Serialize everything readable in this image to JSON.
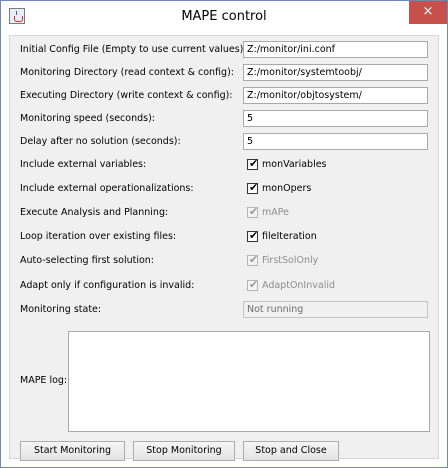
{
  "window": {
    "title": "MAPE control",
    "close_label": "×"
  },
  "fields": {
    "initial_config": {
      "label": "Initial Config File (Empty to use current values):",
      "value": "Z:/monitor/ini.conf"
    },
    "monitoring_dir": {
      "label": "Monitoring Directory (read context & config):",
      "value": "Z:/monitor/systemtoobj/"
    },
    "executing_dir": {
      "label": "Executing Directory (write context & config):",
      "value": "Z:/monitor/objtosystem/"
    },
    "monitoring_speed": {
      "label": "Monitoring speed (seconds):",
      "value": "5"
    },
    "delay": {
      "label": "Delay after no solution (seconds):",
      "value": "5"
    }
  },
  "options": {
    "ext_vars": {
      "label": "Include external variables:",
      "check_label": "monVariables",
      "checked": true,
      "enabled": true
    },
    "ext_opers": {
      "label": "Include external operationalizations:",
      "check_label": "monOpers",
      "checked": true,
      "enabled": true
    },
    "analysis": {
      "label": "Execute Analysis and Planning:",
      "check_label": "mAPe",
      "checked": true,
      "enabled": false
    },
    "loop": {
      "label": "Loop iteration over existing files:",
      "check_label": "fileIteration",
      "checked": true,
      "enabled": true
    },
    "auto_select": {
      "label": "Auto-selecting first solution:",
      "check_label": "FirstSolOnly",
      "checked": true,
      "enabled": false
    },
    "adapt": {
      "label": "Adapt only if configuration is invalid:",
      "check_label": "AdaptOnInvalid",
      "checked": true,
      "enabled": false
    }
  },
  "state": {
    "label": "Monitoring state:",
    "value": "Not running"
  },
  "log": {
    "label": "MAPE log:",
    "value": ""
  },
  "buttons": {
    "start": "Start Monitoring",
    "stop": "Stop Monitoring",
    "stop_close": "Stop and Close"
  },
  "check_glyph": "✔"
}
